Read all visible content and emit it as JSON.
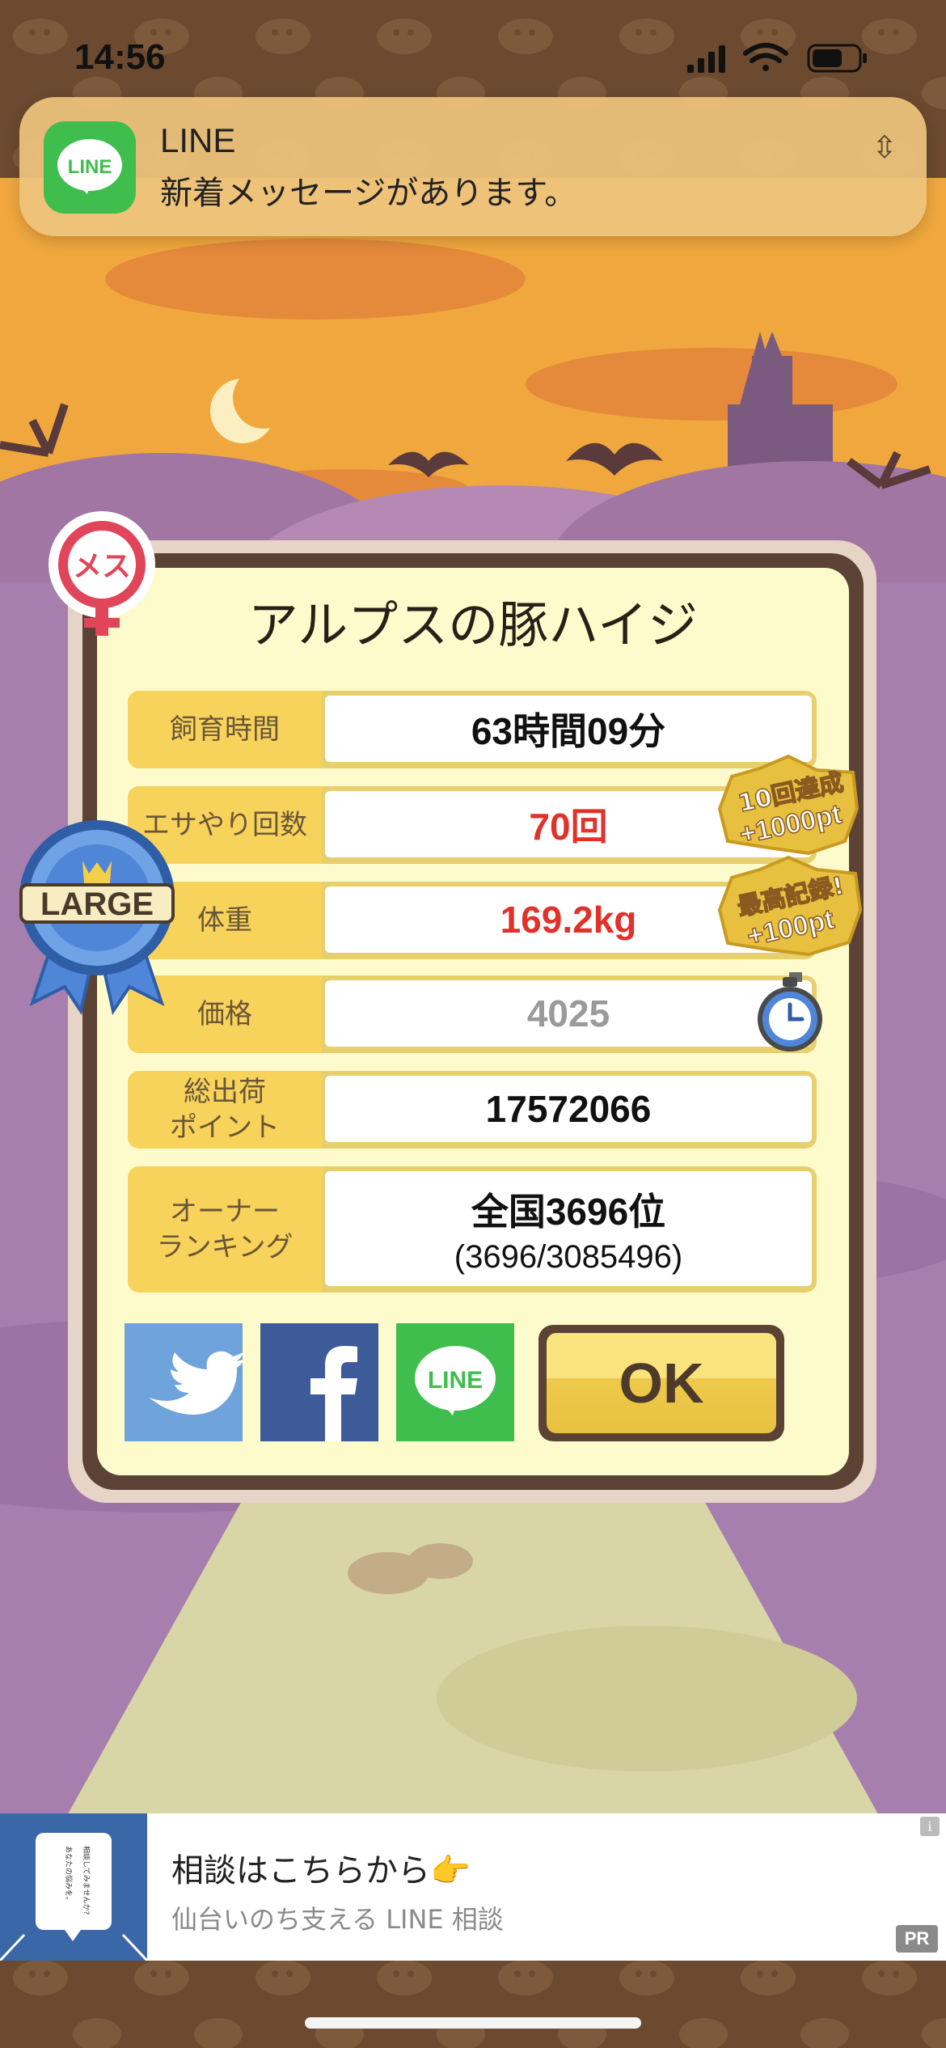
{
  "status_bar": {
    "time": "14:56",
    "icons": [
      "signal-icon",
      "wifi-icon",
      "battery-icon"
    ]
  },
  "notification": {
    "app": "LINE",
    "icon_label": "LINE",
    "message": "新着メッセージがあります。",
    "more": "⇳"
  },
  "badges": {
    "gender": "メス",
    "size": "LARGE",
    "bonus_1": [
      "10回達成",
      "+1000pt"
    ],
    "bonus_2": [
      "最高記録!",
      "+100pt"
    ]
  },
  "dialog": {
    "title": "アルプスの豚ハイジ",
    "rows": [
      {
        "label": "飼育時間",
        "value": "63時間09分"
      },
      {
        "label": "エサやり回数",
        "value": "70回"
      },
      {
        "label": "体重",
        "value": "169.2kg"
      },
      {
        "label": "価格",
        "value": "4025"
      },
      {
        "label": "総出荷\nポイント",
        "value": "17572066"
      },
      {
        "label": "オーナー\nランキング",
        "value": "全国3696位",
        "sub": "(3696/3085496)"
      }
    ],
    "share": {
      "line_label": "LINE"
    },
    "ok_label": "OK"
  },
  "ad": {
    "title": "相談はこちらから👉",
    "subtitle": "仙台いのち支える LINE 相談",
    "thumb_text": [
      "相談してみませんか?",
      "あなたの悩みを。"
    ],
    "pr": "PR",
    "info": "i"
  },
  "colors": {
    "accent_yellow": "#f7d35b",
    "frame_brown": "#5b4234",
    "value_red": "#e0322a",
    "line_green": "#3fbe4d",
    "twitter_blue": "#6fa3dc",
    "facebook_blue": "#3d5b98"
  }
}
